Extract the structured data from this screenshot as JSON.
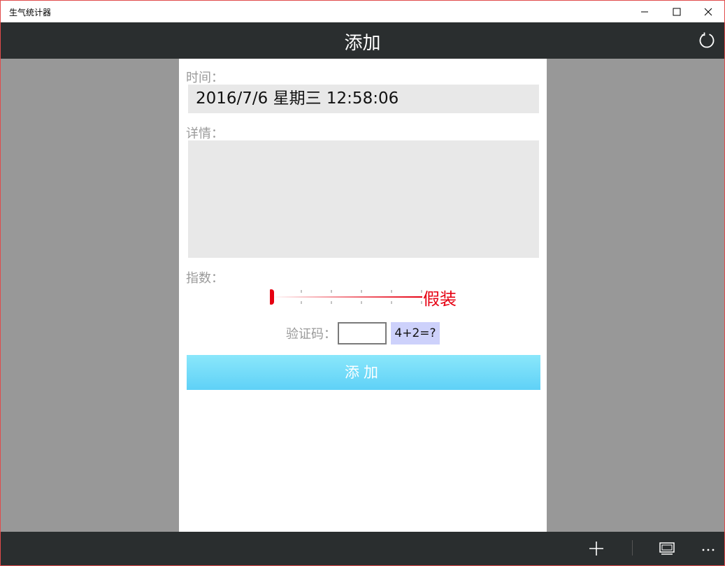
{
  "window": {
    "title": "生气统计器"
  },
  "header": {
    "title": "添加",
    "refresh_icon": "refresh-icon"
  },
  "form": {
    "time_label": "时间：",
    "time_value": "2016/7/6 星期三 12:58:06",
    "detail_label": "详情：",
    "detail_value": "",
    "index_label": "指数：",
    "slider": {
      "value": 0,
      "ticks": 5,
      "value_text": "假装",
      "accent_color": "#e60012"
    },
    "captcha_label": "验证码：",
    "captcha_input": "",
    "captcha_question": "4+2=?",
    "submit_label": "添加"
  },
  "appbar": {
    "icons": [
      "add-icon",
      "view-icon",
      "more-icon"
    ]
  },
  "colors": {
    "header_bg": "#2a2e2f",
    "panel_bg": "#ffffff",
    "backdrop": "#989898",
    "button_bg": "#6fdaf9",
    "captcha_bg": "#cdd1fb"
  }
}
